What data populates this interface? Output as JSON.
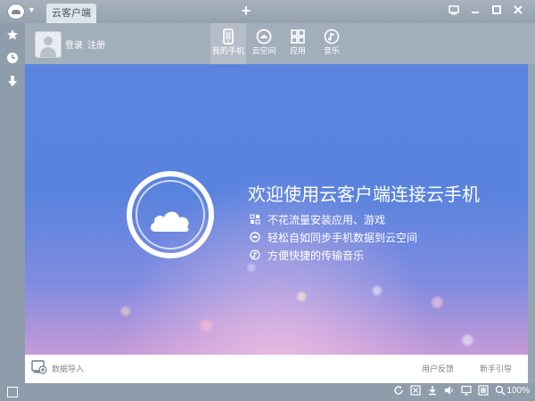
{
  "window": {
    "tab_label": "云客户端",
    "new_tab_symbol": "+"
  },
  "sidebar": {
    "items": [
      {
        "icon": "star-icon",
        "glyph": "★"
      },
      {
        "icon": "clock-icon",
        "glyph": "◷"
      },
      {
        "icon": "download-arrow-icon",
        "glyph": "⬇"
      }
    ]
  },
  "header": {
    "login": "登录",
    "register": "注册",
    "nav": [
      {
        "icon": "phone-icon",
        "label": "我的手机",
        "active": true
      },
      {
        "icon": "cloud-space-icon",
        "label": "云空间",
        "active": false
      },
      {
        "icon": "apps-grid-icon",
        "label": "应用",
        "active": false
      },
      {
        "icon": "music-note-icon",
        "label": "音乐",
        "active": false
      }
    ]
  },
  "hero": {
    "title": "欢迎使用云客户端连接云手机",
    "features": [
      {
        "icon": "apps-small-icon",
        "text": "不花流量安装应用、游戏"
      },
      {
        "icon": "sync-icon",
        "text": "轻松自如同步手机数据到云空间"
      },
      {
        "icon": "music-small-icon",
        "text": "方便快捷的传输音乐"
      }
    ]
  },
  "bottom": {
    "import_label": "数据导入",
    "feedback": "用户反馈",
    "guide": "新手引导"
  },
  "status": {
    "zoom": "100%"
  },
  "colors": {
    "accent": "#5b84e0",
    "chrome": "#97a4b2"
  }
}
